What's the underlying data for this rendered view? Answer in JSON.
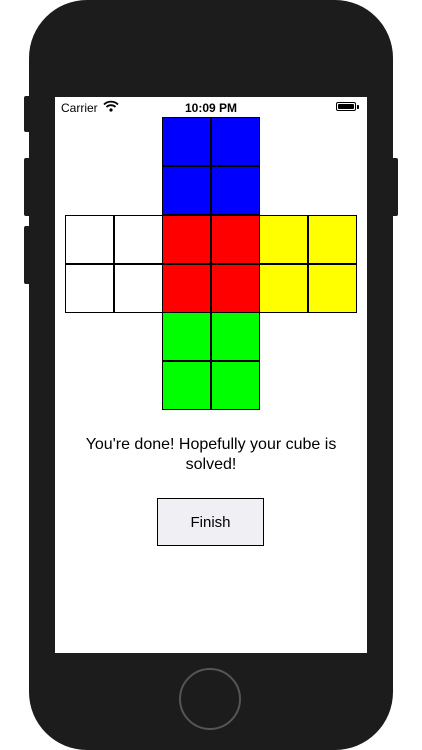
{
  "status_bar": {
    "carrier": "Carrier",
    "time": "10:09 PM",
    "wifi_icon": "wifi-icon",
    "battery_icon": "battery-icon"
  },
  "cube": {
    "top": {
      "color": "#0000ff",
      "cells": 4
    },
    "left": {
      "color": "#ffffff",
      "cells": 4
    },
    "front": {
      "color": "#ff0000",
      "cells": 4
    },
    "right": {
      "color": "#ffff00",
      "cells": 4
    },
    "bottom": {
      "color": "#00ff00",
      "cells": 4
    }
  },
  "message": "You're done! Hopefully your cube is solved!",
  "finish_button": {
    "label": "Finish"
  }
}
